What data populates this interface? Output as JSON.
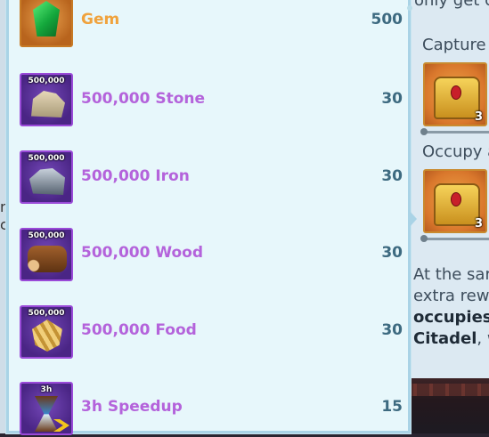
{
  "background": {
    "right_texts": {
      "top_cut": "only get c",
      "capture": "Capture",
      "occupy": "Occupy a",
      "line1": "At the sar",
      "line2": "extra rewa",
      "line3": "occupies",
      "line4_bold": "Citadel",
      "line4_rest": ", w"
    },
    "chests": [
      {
        "count": "3"
      },
      {
        "count": "3"
      }
    ],
    "left_chars": [
      "n",
      "c"
    ]
  },
  "rewards": [
    {
      "icon": "gem-icon",
      "icon_amount": "",
      "label": "Gem",
      "quantity": "500",
      "rarity": "orange"
    },
    {
      "icon": "stone-icon",
      "icon_amount": "500,000",
      "label": "500,000 Stone",
      "quantity": "30",
      "rarity": "purple"
    },
    {
      "icon": "iron-icon",
      "icon_amount": "500,000",
      "label": "500,000 Iron",
      "quantity": "30",
      "rarity": "purple"
    },
    {
      "icon": "wood-icon",
      "icon_amount": "500,000",
      "label": "500,000 Wood",
      "quantity": "30",
      "rarity": "purple"
    },
    {
      "icon": "food-icon",
      "icon_amount": "500,000",
      "label": "500,000 Food",
      "quantity": "30",
      "rarity": "purple"
    },
    {
      "icon": "speedup-icon",
      "icon_amount": "3h",
      "label": "3h Speedup",
      "quantity": "15",
      "rarity": "purple"
    }
  ],
  "colors": {
    "purple_label": "#b463db",
    "orange_label": "#f0a23c",
    "quantity": "#3d6a80",
    "popup_bg": "#e7f7fb"
  }
}
